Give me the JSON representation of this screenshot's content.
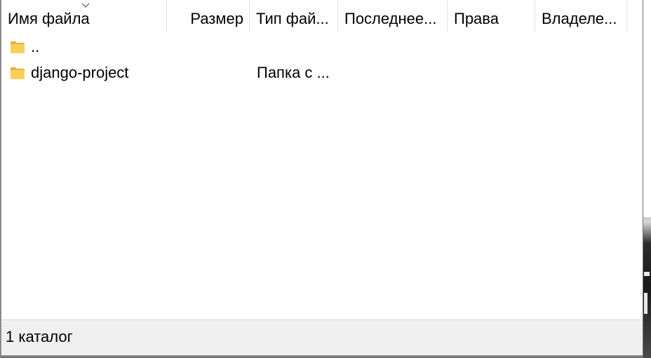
{
  "columns": {
    "name": "Имя файла",
    "size": "Размер",
    "type": "Тип фай...",
    "modified": "Последнее...",
    "permissions": "Права",
    "owner": "Владеле..."
  },
  "sort": {
    "column": "name",
    "direction": "ascending"
  },
  "files": [
    {
      "name": "..",
      "size": "",
      "type": "",
      "icon": "folder-icon"
    },
    {
      "name": "django-project",
      "size": "",
      "type": "Папка с ...",
      "icon": "folder-icon"
    }
  ],
  "status": {
    "text": "1 каталог"
  },
  "colors": {
    "folder": "#f4c542",
    "status_bar": "#f0f0f0"
  }
}
